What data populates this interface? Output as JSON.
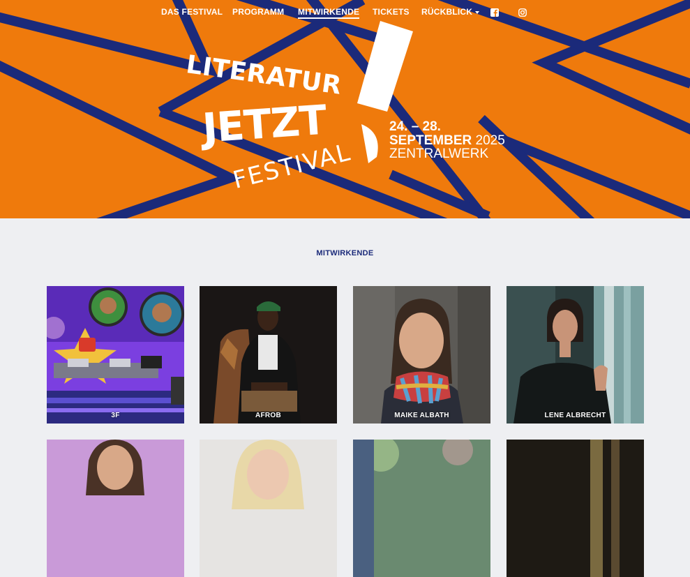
{
  "nav": {
    "items": [
      {
        "label": "DAS FESTIVAL"
      },
      {
        "label": "PROGRAMM"
      },
      {
        "label": "MITWIRKENDE"
      },
      {
        "label": "TICKETS"
      },
      {
        "label": "RÜCKBLICK"
      }
    ],
    "icons": [
      "facebook-icon",
      "instagram-icon"
    ]
  },
  "logo": {
    "line1": "LITERATUR",
    "line2": "JETZT",
    "line3": "FESTIVAL"
  },
  "event": {
    "date_range": "24. – 28.",
    "month": "SEPTEMBER",
    "year": "2025",
    "venue": "ZENTRALWERK"
  },
  "section": {
    "title": "MITWIRKENDE"
  },
  "contributors": [
    {
      "name": "3F"
    },
    {
      "name": "AFROB"
    },
    {
      "name": "MAIKE ALBATH"
    },
    {
      "name": "LENE ALBRECHT"
    }
  ],
  "colors": {
    "brand_orange": "#ef7a0c",
    "brand_blue": "#1b2a7a",
    "page_background": "#eeeff2"
  }
}
